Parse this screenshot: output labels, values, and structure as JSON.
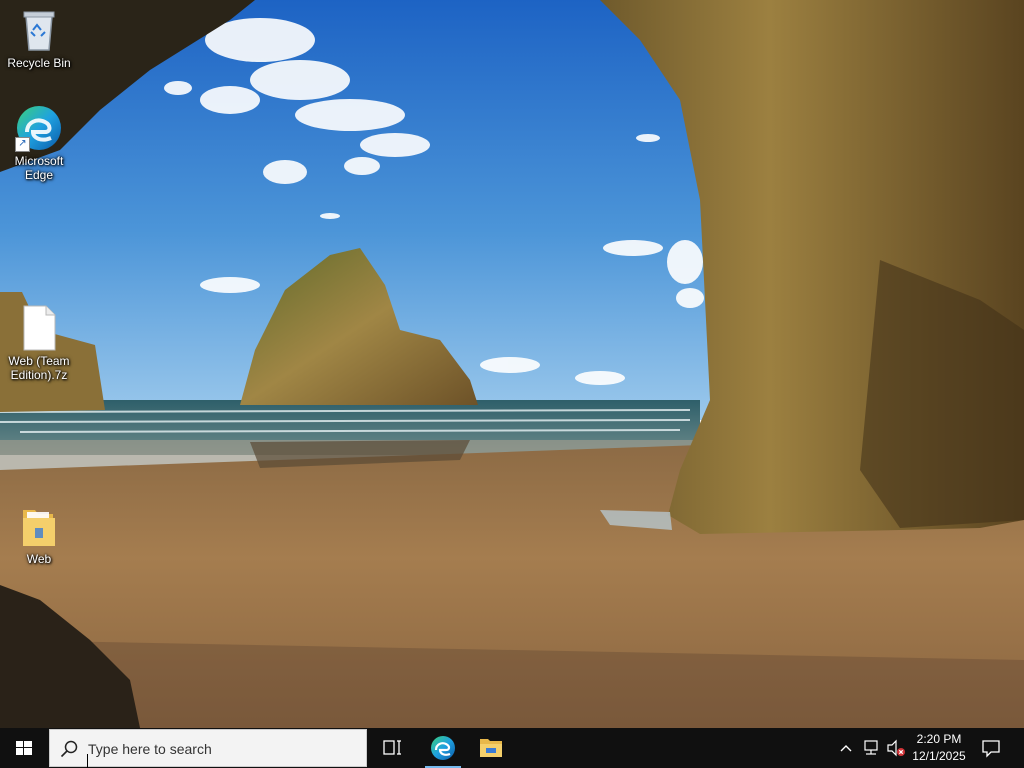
{
  "desktop": {
    "icons": [
      {
        "label": "Recycle Bin",
        "icon": "recycle-bin-icon"
      },
      {
        "label": "Microsoft Edge",
        "icon": "edge-icon"
      },
      {
        "label": "Web (Team Edition).7z",
        "icon": "file-icon"
      },
      {
        "label": "Web",
        "icon": "folder-icon"
      }
    ]
  },
  "taskbar": {
    "start_icon": "windows-logo-icon",
    "search_placeholder": "Type here to search",
    "pinned": [
      {
        "name": "Task View",
        "icon": "task-view-icon"
      },
      {
        "name": "Microsoft Edge",
        "icon": "edge-icon",
        "active": true
      },
      {
        "name": "File Explorer",
        "icon": "folder-icon"
      }
    ],
    "tray": {
      "clock_time": "2:20 PM",
      "clock_date": "12/1/2025"
    }
  },
  "colors": {
    "taskbar_bg": "#101010",
    "search_bg": "#f3f3f3",
    "active_indicator": "#76b9ed"
  }
}
